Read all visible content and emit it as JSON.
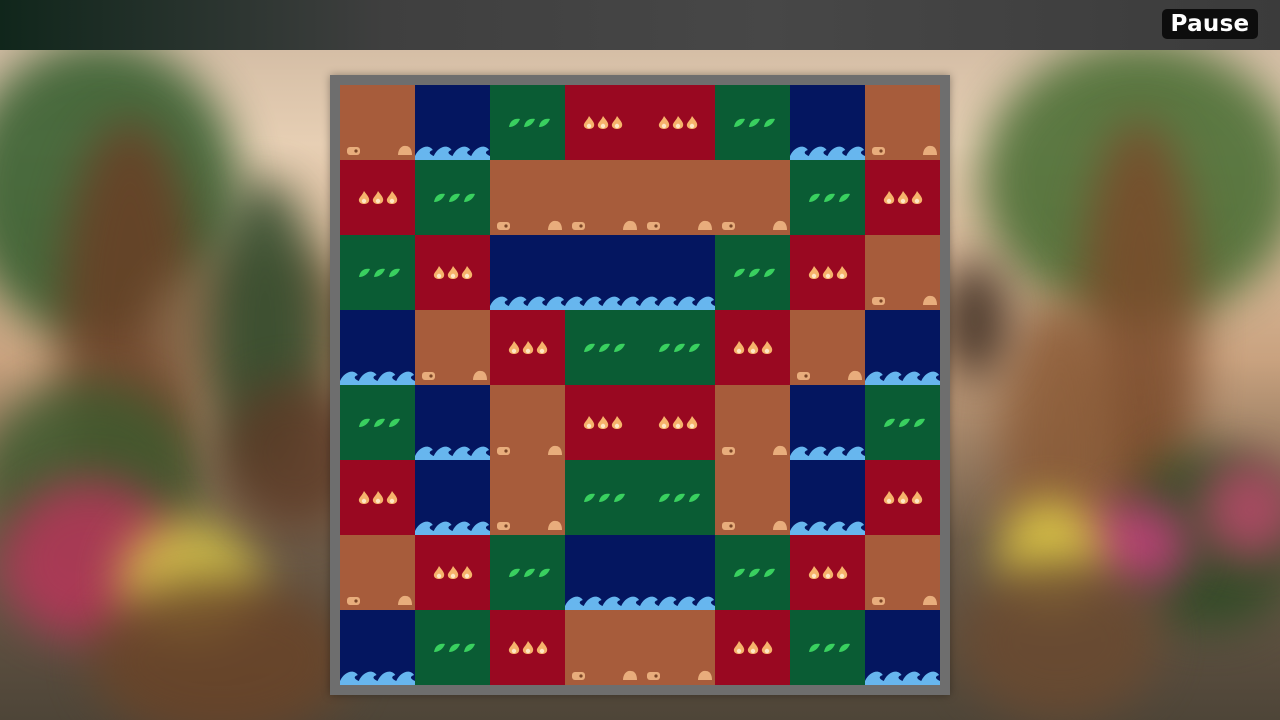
{
  "ui": {
    "pause_label": "Pause"
  },
  "colors": {
    "water": "#041660",
    "grass": "#0a5c34",
    "fire": "#990821",
    "dirt": "#a75c3b",
    "wave": "#67b6ee",
    "leaf": "#39d05f",
    "flame": "#f6b36b",
    "pebble": "#e8ad7c",
    "frame": "#6e6e6e"
  },
  "board": {
    "cols": 8,
    "rows": 8,
    "tiles": [
      {
        "type": "dirt",
        "row": 0,
        "col": 0,
        "w": 1,
        "h": 1
      },
      {
        "type": "water",
        "row": 0,
        "col": 1,
        "w": 1,
        "h": 1
      },
      {
        "type": "grass",
        "row": 0,
        "col": 2,
        "w": 1,
        "h": 1
      },
      {
        "type": "fire",
        "row": 0,
        "col": 3,
        "w": 2,
        "h": 1
      },
      {
        "type": "grass",
        "row": 0,
        "col": 5,
        "w": 1,
        "h": 1
      },
      {
        "type": "water",
        "row": 0,
        "col": 6,
        "w": 1,
        "h": 1
      },
      {
        "type": "dirt",
        "row": 0,
        "col": 7,
        "w": 1,
        "h": 1
      },
      {
        "type": "fire",
        "row": 1,
        "col": 0,
        "w": 1,
        "h": 1
      },
      {
        "type": "grass",
        "row": 1,
        "col": 1,
        "w": 1,
        "h": 1
      },
      {
        "type": "dirt",
        "row": 1,
        "col": 2,
        "w": 4,
        "h": 1
      },
      {
        "type": "grass",
        "row": 1,
        "col": 6,
        "w": 1,
        "h": 1
      },
      {
        "type": "fire",
        "row": 1,
        "col": 7,
        "w": 1,
        "h": 1
      },
      {
        "type": "grass",
        "row": 2,
        "col": 0,
        "w": 1,
        "h": 1
      },
      {
        "type": "fire",
        "row": 2,
        "col": 1,
        "w": 1,
        "h": 1
      },
      {
        "type": "water",
        "row": 2,
        "col": 2,
        "w": 3,
        "h": 1
      },
      {
        "type": "grass",
        "row": 2,
        "col": 5,
        "w": 1,
        "h": 1
      },
      {
        "type": "fire",
        "row": 2,
        "col": 6,
        "w": 1,
        "h": 1
      },
      {
        "type": "dirt",
        "row": 2,
        "col": 7,
        "w": 1,
        "h": 1
      },
      {
        "type": "water",
        "row": 3,
        "col": 0,
        "w": 1,
        "h": 1
      },
      {
        "type": "dirt",
        "row": 3,
        "col": 1,
        "w": 1,
        "h": 1
      },
      {
        "type": "fire",
        "row": 3,
        "col": 2,
        "w": 1,
        "h": 1
      },
      {
        "type": "grass",
        "row": 3,
        "col": 3,
        "w": 2,
        "h": 1
      },
      {
        "type": "fire",
        "row": 3,
        "col": 5,
        "w": 1,
        "h": 1
      },
      {
        "type": "dirt",
        "row": 3,
        "col": 6,
        "w": 1,
        "h": 1
      },
      {
        "type": "water",
        "row": 3,
        "col": 7,
        "w": 1,
        "h": 1
      },
      {
        "type": "grass",
        "row": 4,
        "col": 0,
        "w": 1,
        "h": 1
      },
      {
        "type": "water",
        "row": 4,
        "col": 1,
        "w": 1,
        "h": 1
      },
      {
        "type": "dirt",
        "row": 4,
        "col": 2,
        "w": 1,
        "h": 1
      },
      {
        "type": "fire",
        "row": 4,
        "col": 3,
        "w": 2,
        "h": 1
      },
      {
        "type": "dirt",
        "row": 4,
        "col": 5,
        "w": 1,
        "h": 1
      },
      {
        "type": "water",
        "row": 4,
        "col": 6,
        "w": 1,
        "h": 1
      },
      {
        "type": "grass",
        "row": 4,
        "col": 7,
        "w": 1,
        "h": 1
      },
      {
        "type": "fire",
        "row": 5,
        "col": 0,
        "w": 1,
        "h": 1
      },
      {
        "type": "water",
        "row": 5,
        "col": 1,
        "w": 1,
        "h": 1
      },
      {
        "type": "dirt",
        "row": 5,
        "col": 2,
        "w": 1,
        "h": 1
      },
      {
        "type": "grass",
        "row": 5,
        "col": 3,
        "w": 2,
        "h": 1
      },
      {
        "type": "dirt",
        "row": 5,
        "col": 5,
        "w": 1,
        "h": 1
      },
      {
        "type": "water",
        "row": 5,
        "col": 6,
        "w": 1,
        "h": 1
      },
      {
        "type": "fire",
        "row": 5,
        "col": 7,
        "w": 1,
        "h": 1
      },
      {
        "type": "dirt",
        "row": 6,
        "col": 0,
        "w": 1,
        "h": 1
      },
      {
        "type": "fire",
        "row": 6,
        "col": 1,
        "w": 1,
        "h": 1
      },
      {
        "type": "grass",
        "row": 6,
        "col": 2,
        "w": 1,
        "h": 1
      },
      {
        "type": "water",
        "row": 6,
        "col": 3,
        "w": 2,
        "h": 1
      },
      {
        "type": "grass",
        "row": 6,
        "col": 5,
        "w": 1,
        "h": 1
      },
      {
        "type": "fire",
        "row": 6,
        "col": 6,
        "w": 1,
        "h": 1
      },
      {
        "type": "dirt",
        "row": 6,
        "col": 7,
        "w": 1,
        "h": 1
      },
      {
        "type": "water",
        "row": 7,
        "col": 0,
        "w": 1,
        "h": 1
      },
      {
        "type": "grass",
        "row": 7,
        "col": 1,
        "w": 1,
        "h": 1
      },
      {
        "type": "fire",
        "row": 7,
        "col": 2,
        "w": 1,
        "h": 1
      },
      {
        "type": "dirt",
        "row": 7,
        "col": 3,
        "w": 2,
        "h": 1
      },
      {
        "type": "fire",
        "row": 7,
        "col": 5,
        "w": 1,
        "h": 1
      },
      {
        "type": "grass",
        "row": 7,
        "col": 6,
        "w": 1,
        "h": 1
      },
      {
        "type": "water",
        "row": 7,
        "col": 7,
        "w": 1,
        "h": 1
      }
    ]
  }
}
